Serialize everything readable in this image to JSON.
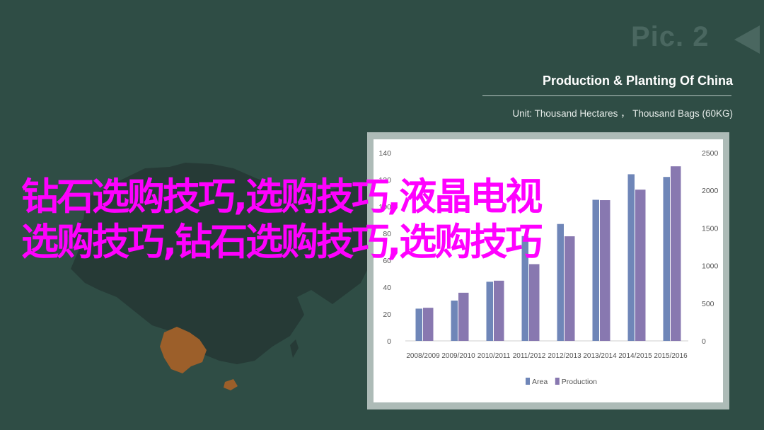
{
  "slide": {
    "pic_label": "Pic. 2",
    "title": "Production & Planting Of China",
    "subtitle": "Unit: Thousand Hectares ， Thousand Bags (60KG)"
  },
  "overlay": {
    "line1": "钻石选购技巧,选购技巧,液晶电视",
    "line2": "选购技巧,钻石选购技巧,选购技巧"
  },
  "colors": {
    "background": "#2f4d45",
    "map_land": "#263a36",
    "map_highlight": "#9c5f2a",
    "overlay_text": "#ff00ff",
    "area_bar": "#6f86b8",
    "production_bar": "#8878b0"
  },
  "chart_data": {
    "type": "bar",
    "categories": [
      "2008/2009",
      "2009/2010",
      "2010/2011",
      "2011/2012",
      "2012/2013",
      "2013/2014",
      "2014/2015",
      "2015/2016"
    ],
    "series": [
      {
        "name": "Area",
        "axis": "left",
        "values": [
          24,
          30,
          44,
          78,
          87,
          105,
          124,
          122
        ]
      },
      {
        "name": "Production",
        "axis": "right",
        "values": [
          440,
          640,
          800,
          1020,
          1390,
          1870,
          2010,
          2320
        ]
      }
    ],
    "y_left": {
      "min": 0,
      "max": 140,
      "ticks": [
        0,
        20,
        40,
        60,
        80,
        100,
        120,
        140
      ]
    },
    "y_right": {
      "min": 0,
      "max": 2500,
      "ticks": [
        0,
        500,
        1000,
        1500,
        2000,
        2500
      ]
    },
    "legend": {
      "position": "bottom",
      "items": [
        "Area",
        "Production"
      ]
    },
    "grid": false
  }
}
